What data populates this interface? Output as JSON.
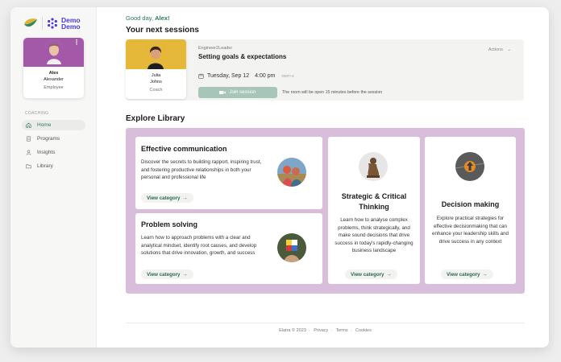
{
  "brand": {
    "logo_line1": "Demo",
    "logo_line2": "Demo",
    "leaf_color": "#e0b23a",
    "accent": "#4a3ad6"
  },
  "user": {
    "first_name": "Alex",
    "last_name": "Alexander",
    "role": "Employee"
  },
  "sidebar": {
    "section_label": "COACHING",
    "items": [
      {
        "label": "Home",
        "icon": "home-icon",
        "active": true
      },
      {
        "label": "Programs",
        "icon": "document-icon",
        "active": false
      },
      {
        "label": "Insights",
        "icon": "person-icon",
        "active": false
      },
      {
        "label": "Library",
        "icon": "folder-icon",
        "active": false
      }
    ]
  },
  "main": {
    "greeting_prefix": "Good day, ",
    "greeting_name": "Alex!",
    "sessions_heading": "Your next sessions",
    "session": {
      "coach_first": "Julia",
      "coach_last": "Johns",
      "coach_role": "Coach",
      "program": "Engineer2Leader",
      "title": "Setting goals & expectations",
      "actions_label": "Actions",
      "date": "Tuesday, Sep 12",
      "time": "4:00 pm",
      "timezone": "GMT+4",
      "join_label": "Join session",
      "room_note": "The room will be open 15 minutes before the session"
    },
    "library_heading": "Explore Library",
    "library_cards": [
      {
        "title": "Effective communication",
        "description": "Discover the secrets to building rapport, inspiring trust, and fostering productive relationships in both your personal and professional life",
        "button": "View category"
      },
      {
        "title": "Problem solving",
        "description": "Learn how to approach problems with a clear and analytical mindset, identify root causes, and develop solutions that drive innovation, growth, and success",
        "button": "View category"
      },
      {
        "title": "Strategic & Critical Thinking",
        "description": "Learn how to analyse complex problems, think strategically, and make sound decisions that drive success in today's rapidly-changing business landscape",
        "button": "View category"
      },
      {
        "title": "Decision making",
        "description": "Explore practical strategies for effective decisionmaking that can enhance your leadership skills and drive success in any context",
        "button": "View category"
      }
    ]
  },
  "footer": {
    "copyright": "Elatra © 2023",
    "links": [
      "Privacy",
      "Terms",
      "Cookies"
    ]
  },
  "colors": {
    "green": "#2a7a56",
    "profile_banner": "#a458a8",
    "coach_banner": "#e5b83a",
    "library_bg": "#d8bedb",
    "join_button": "#a8c6b7"
  }
}
